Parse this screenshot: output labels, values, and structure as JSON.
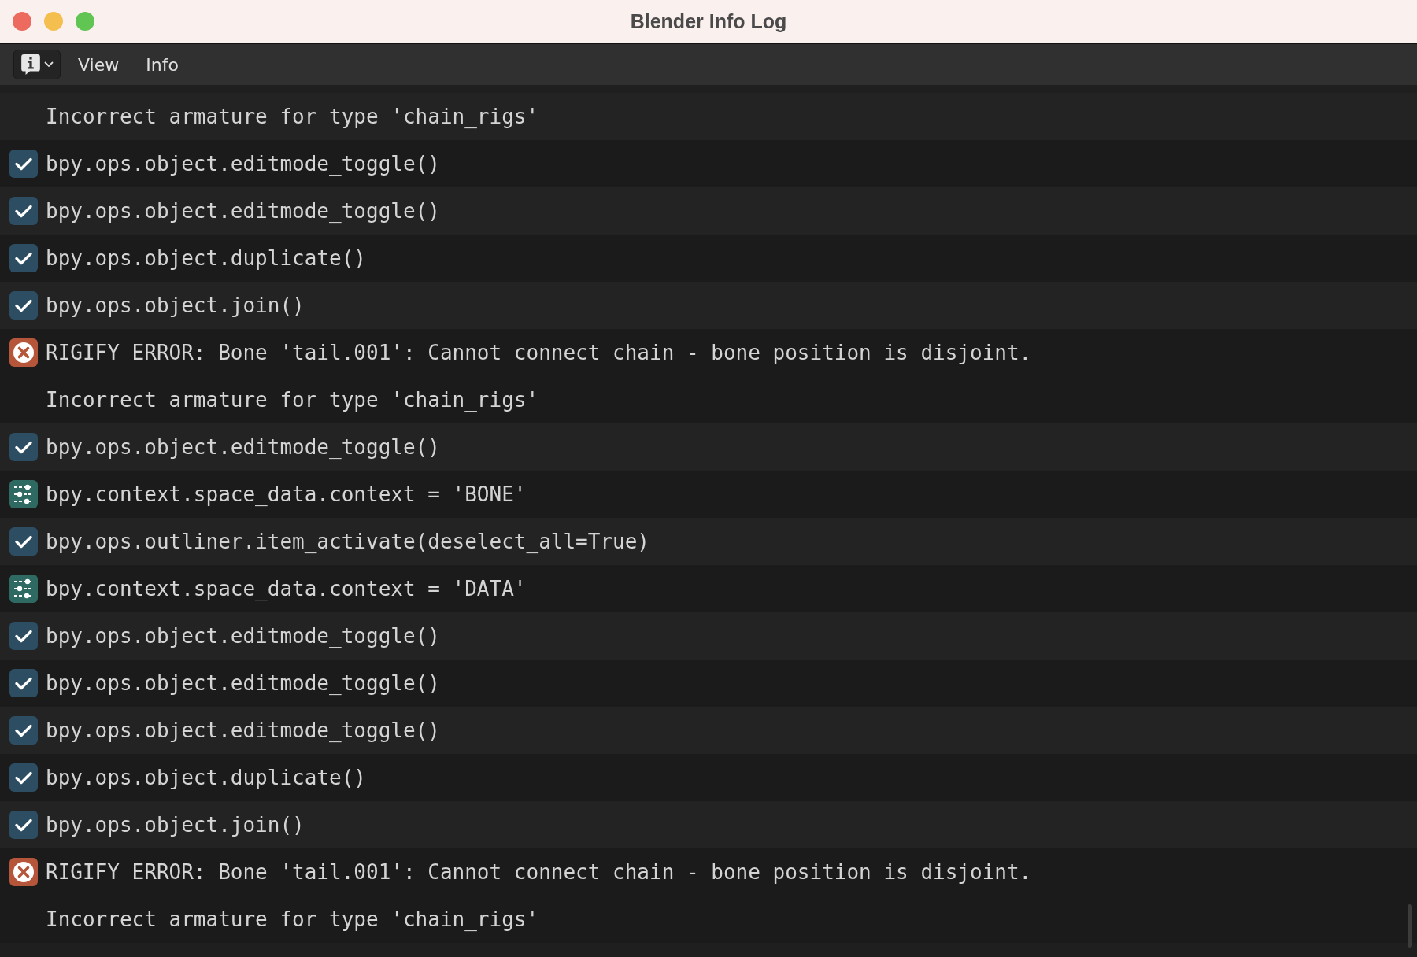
{
  "window": {
    "title": "Blender Info Log"
  },
  "header": {
    "menus": [
      "View",
      "Info"
    ]
  },
  "reports": [
    {
      "kind": "info",
      "lines": [
        "Incorrect armature for type 'chain_rigs'"
      ]
    },
    {
      "kind": "operator",
      "lines": [
        "bpy.ops.object.editmode_toggle()"
      ]
    },
    {
      "kind": "operator",
      "lines": [
        "bpy.ops.object.editmode_toggle()"
      ]
    },
    {
      "kind": "operator",
      "lines": [
        "bpy.ops.object.duplicate()"
      ]
    },
    {
      "kind": "operator",
      "lines": [
        "bpy.ops.object.join()"
      ]
    },
    {
      "kind": "error",
      "lines": [
        "RIGIFY ERROR: Bone 'tail.001': Cannot connect chain - bone position is disjoint.",
        "Incorrect armature for type 'chain_rigs'"
      ]
    },
    {
      "kind": "operator",
      "lines": [
        "bpy.ops.object.editmode_toggle()"
      ]
    },
    {
      "kind": "property",
      "lines": [
        "bpy.context.space_data.context = 'BONE'"
      ]
    },
    {
      "kind": "operator",
      "lines": [
        "bpy.ops.outliner.item_activate(deselect_all=True)"
      ]
    },
    {
      "kind": "property",
      "lines": [
        "bpy.context.space_data.context = 'DATA'"
      ]
    },
    {
      "kind": "operator",
      "lines": [
        "bpy.ops.object.editmode_toggle()"
      ]
    },
    {
      "kind": "operator",
      "lines": [
        "bpy.ops.object.editmode_toggle()"
      ]
    },
    {
      "kind": "operator",
      "lines": [
        "bpy.ops.object.editmode_toggle()"
      ]
    },
    {
      "kind": "operator",
      "lines": [
        "bpy.ops.object.duplicate()"
      ]
    },
    {
      "kind": "operator",
      "lines": [
        "bpy.ops.object.join()"
      ]
    },
    {
      "kind": "error",
      "lines": [
        "RIGIFY ERROR: Bone 'tail.001': Cannot connect chain - bone position is disjoint.",
        "Incorrect armature for type 'chain_rigs'"
      ]
    }
  ]
}
